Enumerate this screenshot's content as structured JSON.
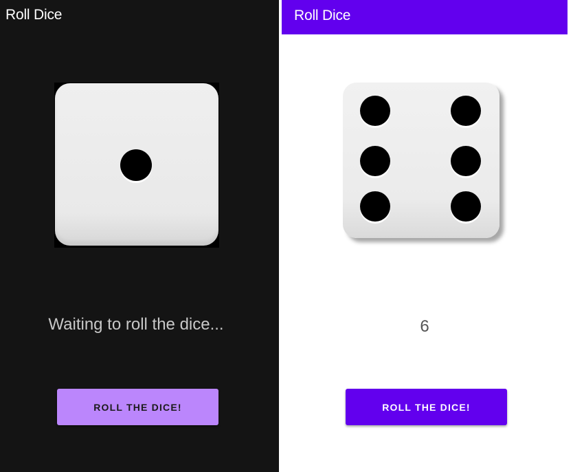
{
  "dark_screen": {
    "app_title": "Roll Dice",
    "die_face": 1,
    "status_text": "Waiting to roll the dice...",
    "roll_button_label": "ROLL THE DICE!",
    "colors": {
      "background": "#141414",
      "button": "#bb86fc"
    }
  },
  "light_screen": {
    "app_title": "Roll Dice",
    "die_face": 6,
    "result_text": "6",
    "roll_button_label": "ROLL THE DICE!",
    "colors": {
      "app_bar": "#6200ee",
      "button": "#6200ee"
    }
  }
}
